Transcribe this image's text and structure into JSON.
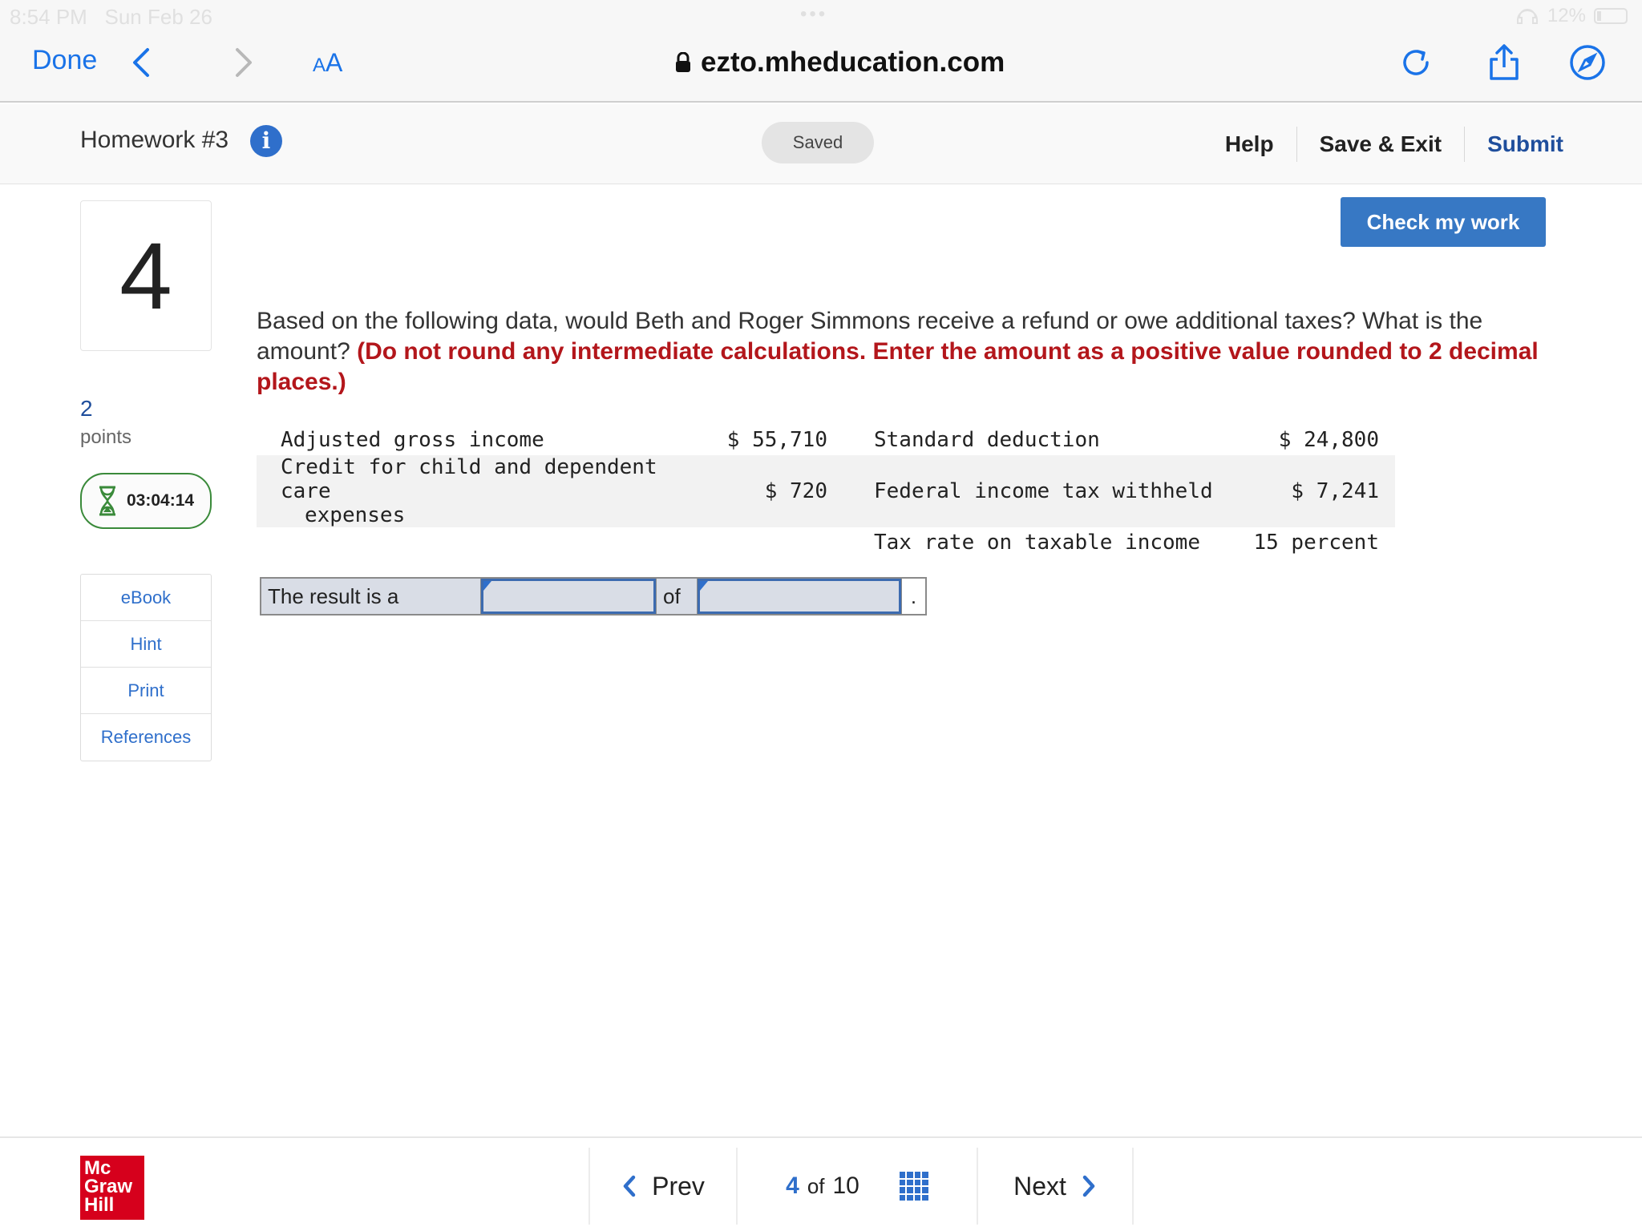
{
  "status_bar": {
    "time": "8:54 PM",
    "date": "Sun Feb 26",
    "battery": "12%"
  },
  "browser": {
    "done_label": "Done",
    "aa_label_small": "A",
    "aa_label_big": "A",
    "url": "ezto.mheducation.com",
    "accent_color": "#1a73e8"
  },
  "header": {
    "title": "Homework #3",
    "saved_label": "Saved",
    "help_label": "Help",
    "save_exit_label": "Save & Exit",
    "submit_label": "Submit"
  },
  "sidebar": {
    "question_number": "4",
    "points_value": "2",
    "points_label": "points",
    "timer": "03:04:14",
    "tools": [
      "eBook",
      "Hint",
      "Print",
      "References"
    ]
  },
  "main": {
    "check_label": "Check my work",
    "question_text": "Based on the following data, would Beth and Roger Simmons receive a refund or owe additional taxes? What is the amount?",
    "instructions": "(Do not round any intermediate calculations. Enter the amount as a positive value rounded to 2 decimal places.)",
    "instruction_color": "#b3161b",
    "table": {
      "rows": [
        {
          "label": "Adjusted gross income",
          "value": "$ 55,710",
          "label2": "Standard deduction",
          "value2": "$ 24,800"
        },
        {
          "label_line1": "Credit for child and dependent care",
          "label_line2": "expenses",
          "value": "$ 720",
          "label2": "Federal income tax withheld",
          "value2": "$ 7,241"
        },
        {
          "label2": "Tax rate on taxable income",
          "value2": "15 percent"
        }
      ]
    },
    "answer": {
      "prefix": "The result is a",
      "result_value": "",
      "of_label": "of",
      "amount_value": "",
      "suffix": "."
    }
  },
  "footer": {
    "logo_line1": "Mc",
    "logo_line2": "Graw",
    "logo_line3": "Hill",
    "prev_label": "Prev",
    "current_page": "4",
    "of_label": "of",
    "total_pages": "10",
    "next_label": "Next"
  }
}
